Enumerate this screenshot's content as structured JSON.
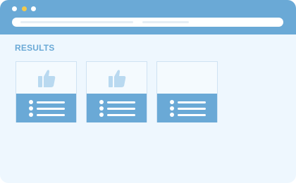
{
  "colors": {
    "accent": "#6aa9d6",
    "background": "#eef7fe",
    "dot_1": "#ffffff",
    "dot_2": "#f2c94c",
    "dot_3": "#ffffff",
    "icon": "#b9d9f0"
  },
  "header": {
    "title": "RESULTS"
  },
  "cards": [
    {
      "icon": "thumbs-up-icon",
      "items": 3
    },
    {
      "icon": "thumbs-up-icon",
      "items": 3
    },
    {
      "icon": "",
      "items": 3
    }
  ]
}
